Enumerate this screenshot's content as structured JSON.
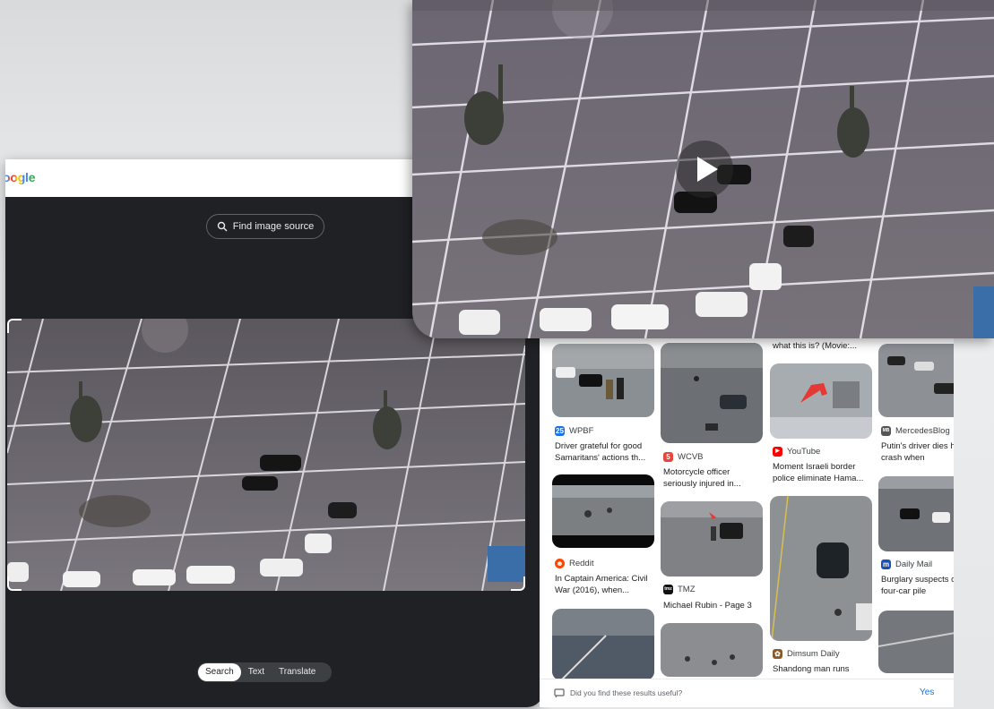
{
  "lens": {
    "logo": "oogle",
    "find_source_label": "Find image source",
    "modes": [
      "Search",
      "Text",
      "Translate"
    ],
    "active_mode": "Search"
  },
  "results": {
    "col1": [
      {
        "source": "WPBF",
        "title": "Driver grateful for good Samaritans' actions th...",
        "icon_color": "#1a73e8",
        "icon": "25"
      },
      {
        "source": "Reddit",
        "title": "In Captain America: Civil War (2016), when...",
        "icon_color": "#ff4500",
        "icon": "☻"
      }
    ],
    "col2": [
      {
        "source": "WCVB",
        "title": "Motorcycle officer seriously injured in...",
        "icon_color": "#e8453c",
        "icon": "5"
      },
      {
        "source": "TMZ",
        "title": "Michael Rubin - Page 3",
        "icon_color": "#111111",
        "icon": "tmz"
      }
    ],
    "col3": [
      {
        "title": "what this is? (Movie:..."
      },
      {
        "source": "YouTube",
        "title": "Moment Israeli border police eliminate Hama...",
        "icon_color": "#ff0000",
        "icon": "▶"
      },
      {
        "source": "Dimsum Daily",
        "title": "Shandong man runs",
        "icon_color": "#8b5a2b",
        "icon": "✿"
      }
    ],
    "col4": [
      {
        "source": "MercedesBlog",
        "title": "Putin's driver dies horror crash when",
        "icon_color": "#555555",
        "icon": "MB"
      },
      {
        "source": "Daily Mail",
        "title": "Burglary suspects cause four-car pile",
        "icon_color": "#1a4fb4",
        "icon": "m"
      }
    ]
  },
  "feedback": {
    "question": "Did you find these results useful?",
    "yes_label": "Yes"
  },
  "colors": {
    "lens_bg": "#202124",
    "accent_blue": "#1a73e8",
    "asphalt": "#6e6a72"
  }
}
